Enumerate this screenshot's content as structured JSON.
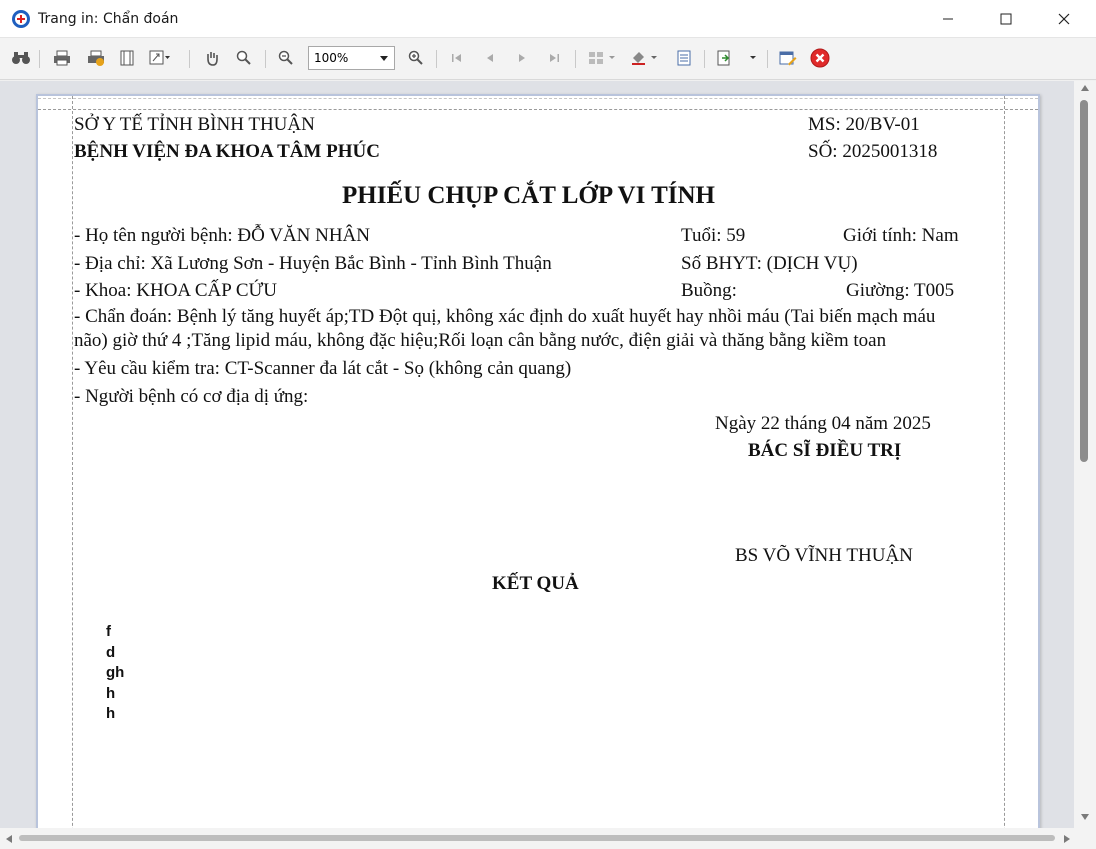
{
  "window": {
    "title": "Trang in: Chẩn đoán",
    "controls": [
      "minimize-icon",
      "maximize-icon",
      "close-icon"
    ]
  },
  "toolbar": {
    "icons": [
      "binoculars-icon",
      "print-icon",
      "quick-print-icon",
      "page-setup-icon",
      "scale-icon",
      "hand-icon",
      "magnifier-icon",
      "zoom-out-icon",
      "zoom-in-icon",
      "first-page-icon",
      "previous-page-icon",
      "next-page-icon",
      "last-page-icon",
      "multiple-pages-icon",
      "background-color-icon",
      "watermark-icon",
      "export-icon",
      "edit-icon",
      "close-preview-icon"
    ],
    "zoom_value": "100%"
  },
  "document": {
    "org_line1": "SỞ Y TẾ TỈNH BÌNH THUẬN",
    "org_line2": "BỆNH VIỆN ĐA KHOA TÂM PHÚC",
    "ms": "MS: 20/BV-01",
    "so": "SỐ: 2025001318",
    "title": "PHIẾU CHỤP CẮT LỚP VI TÍNH",
    "patient_name": "- Họ tên người bệnh: ĐỖ VĂN NHÂN",
    "age": "Tuổi: 59",
    "gender": "Giới tính: Nam",
    "address": "- Địa chỉ: Xã Lương Sơn - Huyện Bắc Bình - Tỉnh Bình Thuận",
    "bhyt": "Số BHYT: (DỊCH VỤ)",
    "department": "- Khoa: KHOA CẤP CỨU",
    "room": "Buồng:",
    "bed": "Giường: T005",
    "diagnosis_line1": "- Chẩn đoán: Bệnh lý tăng huyết áp;TD Đột quị, không xác định do xuất huyết hay nhồi máu (Tai biến mạch máu",
    "diagnosis_line2": "não) giờ thứ 4 ;Tăng lipid máu, không đặc hiệu;Rối loạn cân bằng nước, điện giải và thăng bằng kiềm toan",
    "request": "- Yêu cầu kiểm tra: CT-Scanner  đa lát cắt - Sọ (không cản quang)",
    "allergy": "- Người bệnh có cơ địa dị ứng:",
    "date": "Ngày 22 tháng 04 năm 2025",
    "doctor_title": "BÁC SĨ ĐIỀU TRỊ",
    "doctor_name": "BS VÕ VĨNH THUẬN",
    "result_title": "KẾT QUẢ",
    "result_lines": [
      "f",
      "d",
      "gh",
      "h",
      "h"
    ]
  }
}
